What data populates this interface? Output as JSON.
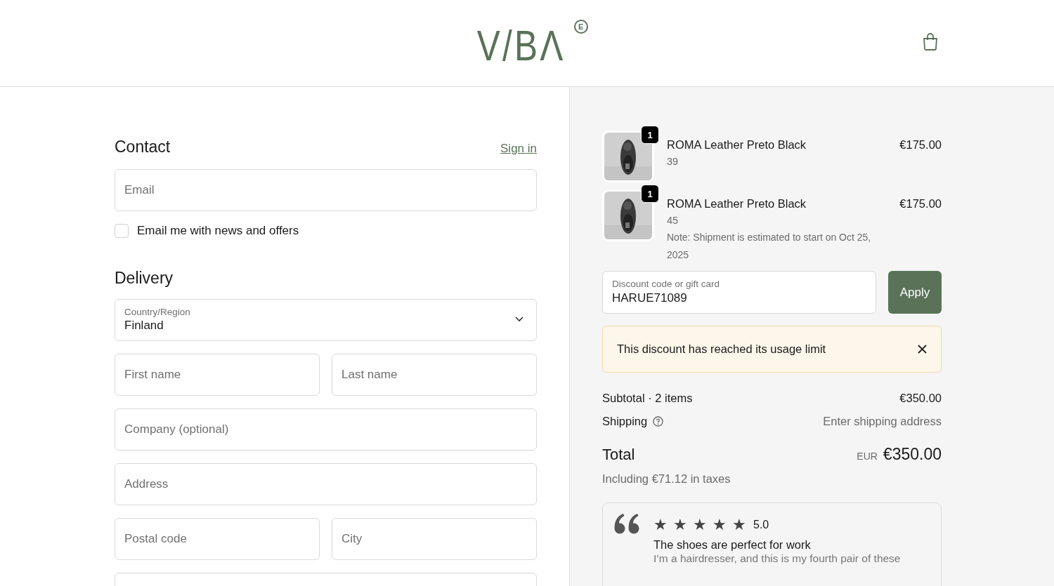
{
  "header": {
    "logo": "V/BΛ",
    "logo_mark": "E"
  },
  "contact": {
    "title": "Contact",
    "sign_in": "Sign in",
    "email": {
      "placeholder": "Email"
    },
    "newsletter": {
      "label": "Email me with news and offers",
      "checked": false
    }
  },
  "delivery": {
    "title": "Delivery",
    "country": {
      "label": "Country/Region",
      "value": "Finland"
    },
    "fields": [
      [
        {
          "placeholder": "First name"
        },
        {
          "placeholder": "Last name"
        }
      ],
      [
        {
          "placeholder": "Company (optional)"
        }
      ],
      [
        {
          "placeholder": "Address"
        }
      ],
      [
        {
          "placeholder": "Postal code"
        },
        {
          "placeholder": "City"
        }
      ]
    ]
  },
  "order": {
    "items": [
      {
        "quantity": "1",
        "name": "ROMA Leather Preto Black",
        "price": "€175.00",
        "size": "39"
      },
      {
        "quantity": "1",
        "name": "ROMA Leather Preto Black",
        "price": "€175.00",
        "size": "45",
        "note": "Note: Shipment is estimated to start on Oct 25, 2025"
      }
    ],
    "discount": {
      "label": "Discount code or gift card",
      "value": "HARUE71089",
      "button": "Apply"
    },
    "alert": {
      "message": "This discount has reached its usage limit"
    },
    "subtotal": {
      "label": "Subtotal · 2 items",
      "value": "€350.00"
    },
    "shipping": {
      "label": "Shipping",
      "value": "Enter shipping address"
    },
    "total": {
      "label": "Total",
      "currency": "EUR",
      "value": "€350.00",
      "taxes": "Including €71.12 in taxes"
    },
    "review": {
      "stars": 5,
      "rating": "5.0",
      "title": "The shoes are perfect for work",
      "body": "I’m a hairdresser, and this is my fourth pair of these"
    }
  }
}
